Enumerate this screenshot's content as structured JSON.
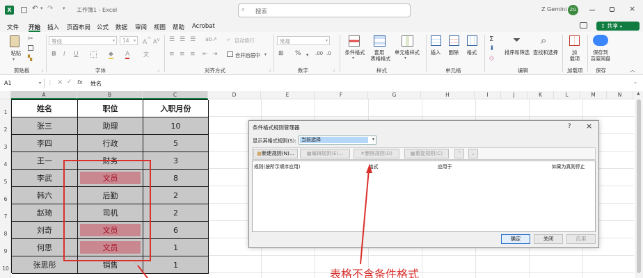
{
  "titlebar": {
    "title": "工作簿1 - Excel",
    "search_placeholder": "搜索",
    "user": "Z Gemini",
    "avatar_initials": "ZG"
  },
  "menu": {
    "items": [
      "文件",
      "开始",
      "插入",
      "页面布局",
      "公式",
      "数据",
      "审阅",
      "视图",
      "帮助",
      "Acrobat"
    ],
    "active": "开始",
    "share": "共享"
  },
  "ribbon": {
    "paste": "粘贴",
    "font_name": "等线",
    "font_size": "14",
    "wrap_text": "自动换行",
    "merge_center": "合并后居中",
    "number_format": "常规",
    "cond_format": "条件格式",
    "table_format_1": "套用",
    "table_format_2": "表格格式",
    "cell_style": "单元格样式",
    "insert": "插入",
    "delete": "删除",
    "format": "格式",
    "sort_filter": "排序和筛选",
    "find_select": "查找和选择",
    "addin_1": "加",
    "addin_2": "载项",
    "save_baidu_1": "保存到",
    "save_baidu_2": "百度网盘",
    "groups": {
      "clipboard": "剪贴板",
      "font": "字体",
      "alignment": "对齐方式",
      "number": "数字",
      "styles": "样式",
      "cells": "单元格",
      "editing": "编辑",
      "addins": "加载项",
      "save": "保存"
    }
  },
  "formula_bar": {
    "name_box": "A1",
    "fx": "fx",
    "content": "姓名"
  },
  "columns": [
    "A",
    "B",
    "C",
    "D",
    "E",
    "F",
    "G",
    "H",
    "I",
    "J",
    "K",
    "L",
    "M",
    "N"
  ],
  "rows": [
    "1",
    "2",
    "3",
    "4",
    "5",
    "6",
    "7",
    "8",
    "9",
    "10"
  ],
  "table": {
    "headers": [
      "姓名",
      "职位",
      "入职月份"
    ],
    "rows": [
      {
        "name": "张三",
        "pos": "助理",
        "month": "10",
        "hl": false
      },
      {
        "name": "李四",
        "pos": "行政",
        "month": "5",
        "hl": false
      },
      {
        "name": "王一",
        "pos": "财务",
        "month": "3",
        "hl": false
      },
      {
        "name": "李武",
        "pos": "文员",
        "month": "8",
        "hl": true
      },
      {
        "name": "韩六",
        "pos": "后勤",
        "month": "2",
        "hl": false
      },
      {
        "name": "赵琦",
        "pos": "司机",
        "month": "2",
        "hl": false
      },
      {
        "name": "刘奇",
        "pos": "文员",
        "month": "6",
        "hl": true
      },
      {
        "name": "何思",
        "pos": "文员",
        "month": "1",
        "hl": true
      },
      {
        "name": "张思彤",
        "pos": "销售",
        "month": "1",
        "hl": false
      }
    ]
  },
  "dialog": {
    "title": "条件格式规则管理器",
    "help": "?",
    "close": "×",
    "show_label": "显示其格式规则(S):",
    "show_value": "当前选择",
    "new_rule": "新建规则(N)...",
    "edit_rule": "编辑规则(E)...",
    "delete_rule": "删除规则(D)",
    "duplicate_rule": "重复规则(C)",
    "col_rule": "规则(按所示顺序应用)",
    "col_format": "格式",
    "col_applies": "应用于",
    "col_stop": "如果为真则停止",
    "ok": "确定",
    "close_btn": "关闭",
    "apply": "应用"
  },
  "annotation": {
    "text": "表格不含条件格式",
    "color": "#d9302c"
  },
  "colors": {
    "excel_green": "#107c41",
    "highlight_fill": "#c9888f",
    "highlight_text": "#a8102a",
    "selected_blue": "#b5d7f8"
  }
}
